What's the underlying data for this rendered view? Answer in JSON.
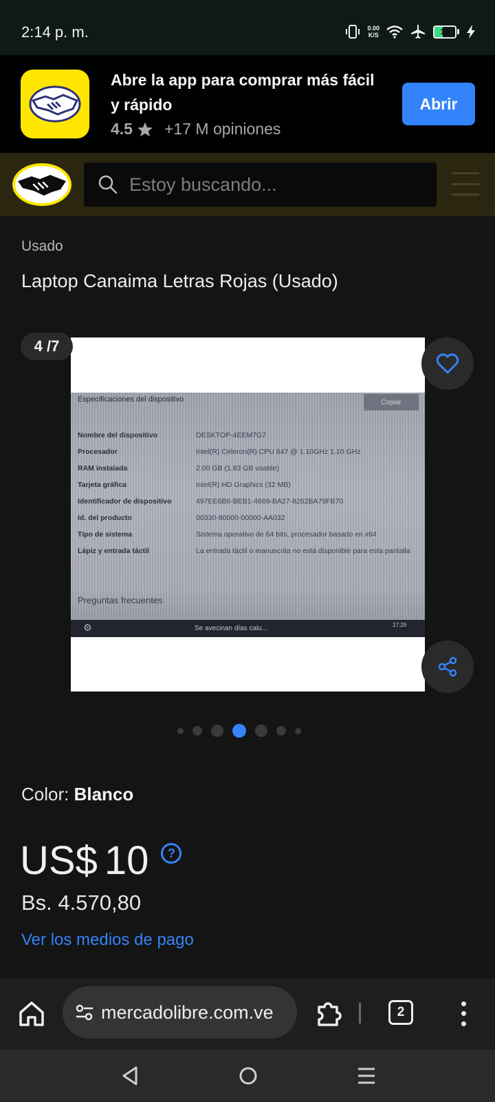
{
  "status_bar": {
    "time": "2:14 p. m.",
    "net_speed_value": "0.00",
    "net_speed_unit": "K/S",
    "battery_level": "18",
    "icons": [
      "vibrate-icon",
      "wifi-icon",
      "airplane-icon",
      "battery-icon",
      "charging-icon"
    ]
  },
  "app_banner": {
    "title": "Abre la app para comprar más fácil y rápido",
    "rating": "4.5",
    "reviews": "+17 M opiniones",
    "open_label": "Abrir"
  },
  "header": {
    "search_placeholder": "Estoy buscando..."
  },
  "product": {
    "condition": "Usado",
    "title": "Laptop Canaima Letras Rojas (Usado)",
    "gallery": {
      "counter": "4 /7",
      "current_index": 4,
      "total": 7,
      "photo": {
        "heading": "Especificaciones del dispositivo",
        "copy_label": "Copiar",
        "specs": [
          {
            "label": "Nombre del dispositivo",
            "value": "DESKTOP-4EEM7G7"
          },
          {
            "label": "Procesador",
            "value": "Intel(R) Celeron(R) CPU 847 @ 1.10GHz   1.10 GHz"
          },
          {
            "label": "RAM instalada",
            "value": "2.00 GB (1.83 GB usable)"
          },
          {
            "label": "Tarjeta gráfica",
            "value": "Intel(R) HD Graphics (32 MB)"
          },
          {
            "label": "Identificador de dispositivo",
            "value": "497EE6B6-BEB1-4669-BA27-8262BA79FB70"
          },
          {
            "label": "Id. del producto",
            "value": "00330-80000-00000-AA032"
          },
          {
            "label": "Tipo de sistema",
            "value": "Sistema operativo de 64 bits, procesador basado en x64"
          },
          {
            "label": "Lápiz y entrada táctil",
            "value": "La entrada táctil o manuscrita no está disponible para esta pantalla"
          }
        ],
        "faq_heading": "Preguntas frecuentes",
        "taskbar_news": "Se avecinan días calu...",
        "taskbar_clock": "17:29"
      }
    },
    "color_label": "Color: ",
    "color_value": "Blanco",
    "price_currency": "US$",
    "price_amount": "10",
    "price_help": "?",
    "price_local": "Bs. 4.570,80",
    "payment_link": "Ver los medios de pago"
  },
  "browser": {
    "url": "mercadolibre.com.ve",
    "tab_count": "2"
  },
  "colors": {
    "accent_blue": "#3483fa",
    "brand_yellow": "#ffe600",
    "background": "#141414"
  }
}
